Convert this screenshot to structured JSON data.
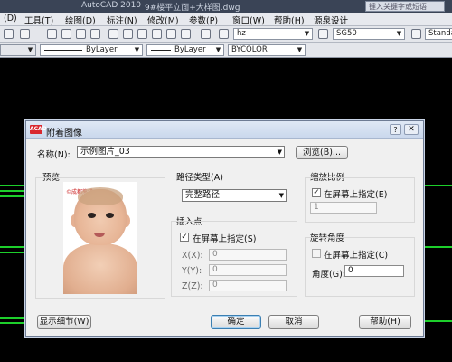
{
  "app": {
    "title": "AutoCAD 2010",
    "filename": "9#楼平立面+大样图.dwg",
    "search_placeholder": "键入关键字或短语"
  },
  "menubar": [
    "(D)",
    "工具(T)",
    "绘图(D)",
    "标注(N)",
    "修改(M)",
    "参数(P)",
    "窗口(W)",
    "帮助(H)",
    "源泉设计"
  ],
  "toolbar": {
    "text_style": "hz",
    "dim_style": "SG50",
    "table_style": "Standa"
  },
  "properties_bar": {
    "linetype": "ByLayer",
    "lineweight": "ByLayer",
    "color": "BYCOLOR"
  },
  "dialog": {
    "title": "附着图像",
    "logo_text": "ACAD",
    "help_glyph": "?",
    "close_glyph": "✕",
    "name_label": "名称(N):",
    "name_value": "示例图片_03",
    "browse_label": "浏览(B)...",
    "preview_label": "预览",
    "preview_watermark": "©成都熊猫",
    "path_type": {
      "label": "路径类型(A)",
      "value": "完整路径"
    },
    "insert_point": {
      "label": "插入点",
      "specify_on_screen": "在屏幕上指定(S)",
      "checked": true,
      "x_label": "X(X):",
      "y_label": "Y(Y):",
      "z_label": "Z(Z):",
      "x": "0",
      "y": "0",
      "z": "0"
    },
    "scale": {
      "label": "缩放比例",
      "specify_on_screen": "在屏幕上指定(E)",
      "checked": true,
      "value": "1"
    },
    "rotation": {
      "label": "旋转角度",
      "specify_on_screen": "在屏幕上指定(C)",
      "checked": false,
      "angle_label": "角度(G):",
      "angle": "0"
    },
    "buttons": {
      "details": "显示细节(W)",
      "ok": "确定",
      "cancel": "取消",
      "help": "帮助(H)"
    }
  },
  "colors": {
    "canvas": "#000000",
    "drawing_lines": "#1dcf2b",
    "dialog_bg": "#f0f0f0"
  }
}
